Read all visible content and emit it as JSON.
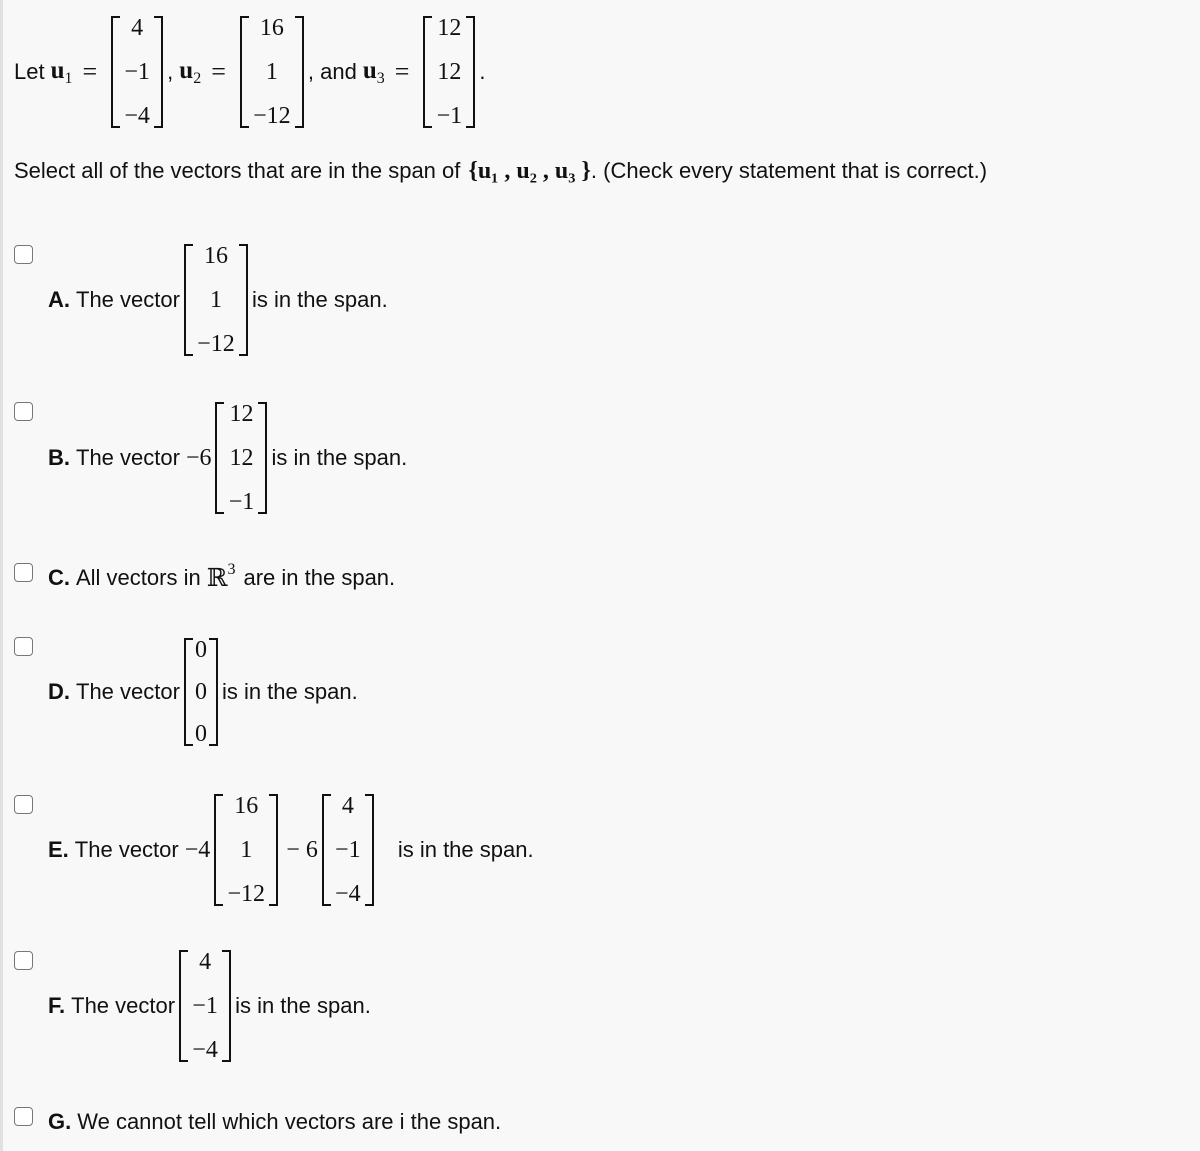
{
  "intro": {
    "let": "Let",
    "u1_symbol": "u",
    "u1_sub": "1",
    "u2_symbol": "u",
    "u2_sub": "2",
    "u3_symbol": "u",
    "u3_sub": "3",
    "equals": "=",
    "comma": ",",
    "and": ", and",
    "period": ".",
    "u1": [
      "4",
      "−1",
      "−4"
    ],
    "u2": [
      "16",
      "1",
      "−12"
    ],
    "u3": [
      "12",
      "12",
      "−1"
    ]
  },
  "instruction": {
    "text": "Select all of the vectors that are in the span of",
    "set": "{u₁ , u₂ , u₃ }",
    "note": ". (Check every statement that is correct.)"
  },
  "options": [
    {
      "letter": "A.",
      "prefix": "The vector",
      "vector": [
        "16",
        "1",
        "−12"
      ],
      "suffix": "is in the span.",
      "checked": false
    },
    {
      "letter": "B.",
      "prefix": "The vector",
      "coef": "−6",
      "vector": [
        "12",
        "12",
        "−1"
      ],
      "suffix": "is in the span.",
      "checked": false
    },
    {
      "letter": "C.",
      "text": "All vectors in",
      "space": "ℝ",
      "exp": "3",
      "suffix": "are in the span.",
      "checked": false
    },
    {
      "letter": "D.",
      "prefix": "The vector",
      "vector": [
        "0",
        "0",
        "0"
      ],
      "suffix": "is in the span.",
      "checked": false
    },
    {
      "letter": "E.",
      "prefix": "The vector",
      "coef1": "−4",
      "vector1": [
        "16",
        "1",
        "−12"
      ],
      "op": "− 6",
      "vector2": [
        "4",
        "−1",
        "−4"
      ],
      "suffix": "is in the span.",
      "checked": false
    },
    {
      "letter": "F.",
      "prefix": "The vector",
      "vector": [
        "4",
        "−1",
        "−4"
      ],
      "suffix": "is in the span.",
      "checked": false
    },
    {
      "letter": "G.",
      "text": "We cannot tell which vectors are i the span.",
      "checked": false
    }
  ]
}
